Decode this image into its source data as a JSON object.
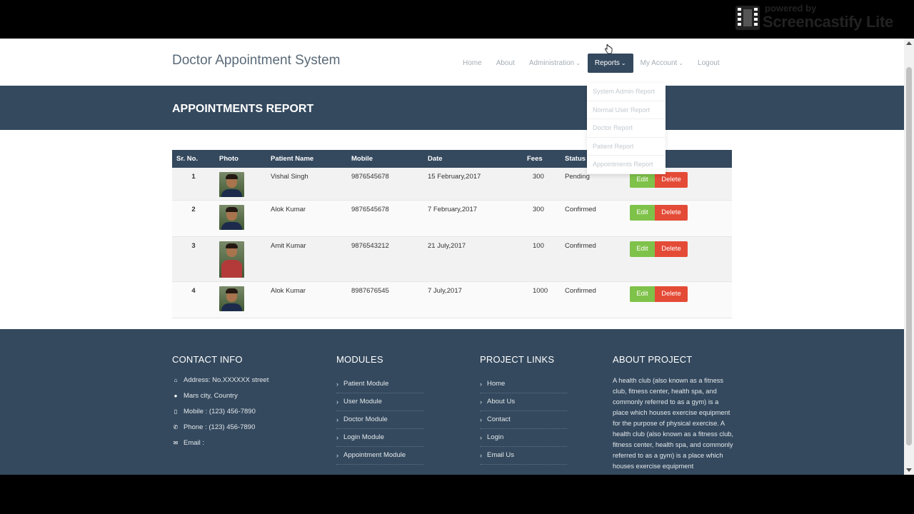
{
  "header": {
    "brand": "Doctor Appointment System",
    "nav": [
      {
        "label": "Home",
        "caret": false,
        "active": false
      },
      {
        "label": "About",
        "caret": false,
        "active": false
      },
      {
        "label": "Administration",
        "caret": true,
        "active": false
      },
      {
        "label": "Reports",
        "caret": true,
        "active": true
      },
      {
        "label": "My Account",
        "caret": true,
        "active": false
      },
      {
        "label": "Logout",
        "caret": false,
        "active": false
      }
    ],
    "caret_glyph": "⌄"
  },
  "watermark": {
    "small": "powered by",
    "big": "Screencastify Lite"
  },
  "reports_menu": [
    "System Admin Report",
    "Normal User Report",
    "Doctor Report",
    "Patient Report",
    "Appointments Report"
  ],
  "banner": {
    "title": "APPOINTMENTS REPORT"
  },
  "table": {
    "headers": {
      "sr": "Sr. No.",
      "photo": "Photo",
      "name": "Patient Name",
      "mobile": "Mobile",
      "date": "Date",
      "fees": "Fees",
      "status": "Status"
    },
    "rows": [
      {
        "sr": "1",
        "name": "Vishal Singh",
        "mobile": "9876545678",
        "date": "15 February,2017",
        "fees": "300",
        "status": "Pending"
      },
      {
        "sr": "2",
        "name": "Alok Kumar",
        "mobile": "9876545678",
        "date": "7 February,2017",
        "fees": "300",
        "status": "Confirmed"
      },
      {
        "sr": "3",
        "name": "Amit Kumar",
        "mobile": "9876543212",
        "date": "21 July,2017",
        "fees": "100",
        "status": "Confirmed"
      },
      {
        "sr": "4",
        "name": "Alok Kumar",
        "mobile": "8987676545",
        "date": "7 July,2017",
        "fees": "1000",
        "status": "Confirmed"
      }
    ],
    "edit_label": "Edit",
    "delete_label": "Delete"
  },
  "footer": {
    "contact": {
      "title": "CONTACT INFO",
      "lines": [
        {
          "icon": "home-icon",
          "glyph": "⌂",
          "text": "Address: No.XXXXXX street"
        },
        {
          "icon": "globe-icon",
          "glyph": "●",
          "text": "Mars city, Country"
        },
        {
          "icon": "mobile-icon",
          "glyph": "▯",
          "text": "Mobile : (123) 456-7890"
        },
        {
          "icon": "phone-icon",
          "glyph": "✆",
          "text": "Phone : (123) 456-7890"
        },
        {
          "icon": "envelope-icon",
          "glyph": "✉",
          "text": "Email :"
        }
      ]
    },
    "modules": {
      "title": "MODULES",
      "items": [
        "Patient Module",
        "User Module",
        "Doctor Module",
        "Login Module",
        "Appointment Module"
      ]
    },
    "project_links": {
      "title": "PROJECT LINKS",
      "items": [
        "Home",
        "About Us",
        "Contact",
        "Login",
        "Email Us"
      ]
    },
    "about": {
      "title": "ABOUT PROJECT",
      "text": "A health club (also known as a fitness club, fitness center, health spa, and commonly referred to as a gym) is a place which houses exercise equipment for the purpose of physical exercise. A health club (also known as a fitness club, fitness center, health spa, and commonly referred to as a gym) is a place which houses exercise equipment"
    },
    "chevron_glyph": "›"
  },
  "colors": {
    "primary": "#34495e",
    "edit": "#7fc24a",
    "delete": "#e44b37"
  }
}
